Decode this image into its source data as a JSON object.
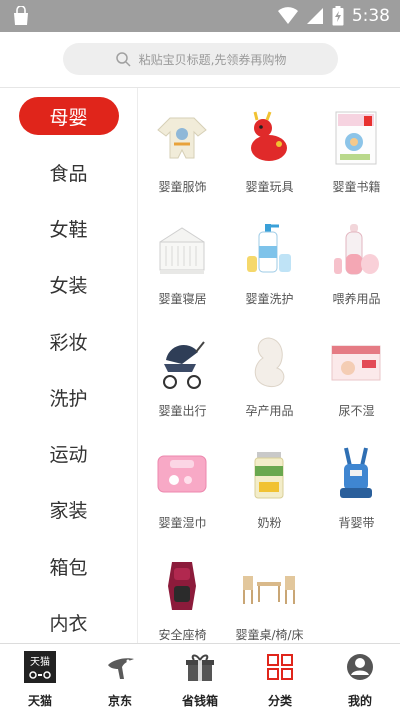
{
  "status_bar": {
    "time": "5:38"
  },
  "search": {
    "placeholder": "粘贴宝贝标题,先领券再购物"
  },
  "sidebar": {
    "items": [
      {
        "label": "母婴",
        "active": true
      },
      {
        "label": "食品"
      },
      {
        "label": "女鞋"
      },
      {
        "label": "女装"
      },
      {
        "label": "彩妆"
      },
      {
        "label": "洗护"
      },
      {
        "label": "运动"
      },
      {
        "label": "家装"
      },
      {
        "label": "箱包"
      },
      {
        "label": "内衣"
      }
    ]
  },
  "grid": {
    "items": [
      {
        "label": "婴童服饰",
        "icon": "baby-romper-icon"
      },
      {
        "label": "婴童玩具",
        "icon": "toy-deer-icon"
      },
      {
        "label": "婴童书籍",
        "icon": "book-icon"
      },
      {
        "label": "婴童寝居",
        "icon": "crib-icon"
      },
      {
        "label": "婴童洗护",
        "icon": "lotion-bottle-icon"
      },
      {
        "label": "喂养用品",
        "icon": "feeding-bottle-icon"
      },
      {
        "label": "婴童出行",
        "icon": "stroller-icon"
      },
      {
        "label": "孕产用品",
        "icon": "pregnancy-pillow-icon"
      },
      {
        "label": "尿不湿",
        "icon": "diaper-box-icon"
      },
      {
        "label": "婴童湿巾",
        "icon": "wet-wipes-icon"
      },
      {
        "label": "奶粉",
        "icon": "formula-can-icon"
      },
      {
        "label": "背婴带",
        "icon": "baby-carrier-icon"
      },
      {
        "label": "安全座椅",
        "icon": "car-seat-icon"
      },
      {
        "label": "婴童桌/椅/床",
        "icon": "table-chairs-icon"
      }
    ]
  },
  "tabbar": {
    "tabs": [
      {
        "label": "天猫",
        "icon": "tmall-icon"
      },
      {
        "label": "京东",
        "icon": "jd-icon"
      },
      {
        "label": "省钱箱",
        "icon": "gift-box-icon"
      },
      {
        "label": "分类",
        "icon": "category-grid-icon",
        "active": true
      },
      {
        "label": "我的",
        "icon": "profile-icon"
      }
    ],
    "tmall_logo_text": "天猫"
  },
  "colors": {
    "accent": "#e0251b",
    "status_bar": "#9e9e9e"
  }
}
